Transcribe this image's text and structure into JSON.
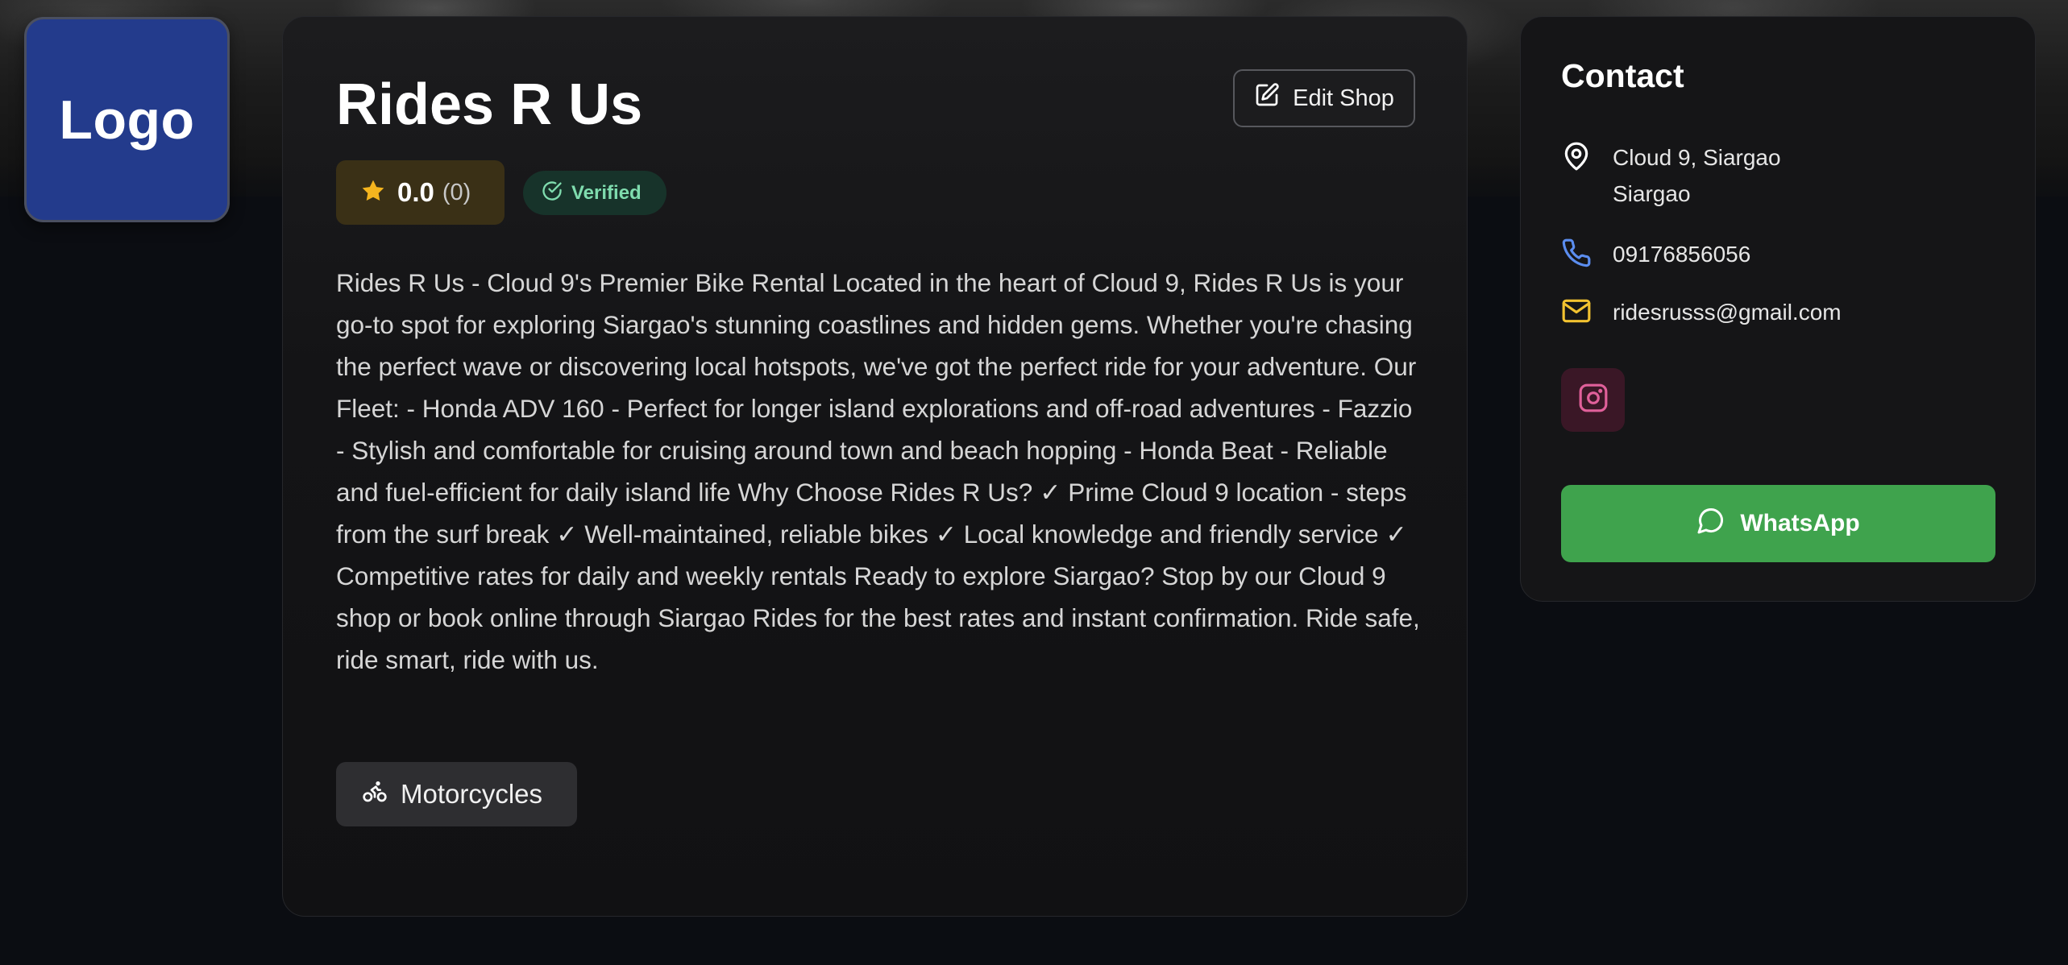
{
  "logo": {
    "text": "Logo"
  },
  "shop": {
    "name": "Rides R Us",
    "edit_label": "Edit Shop",
    "rating": {
      "value": "0.0",
      "count": "(0)"
    },
    "verified_label": "Verified",
    "description": "Rides R Us - Cloud 9's Premier Bike Rental Located in the heart of Cloud 9, Rides R Us is your go-to spot for exploring Siargao's stunning coastlines and hidden gems. Whether you're chasing the perfect wave or discovering local hotspots, we've got the perfect ride for your adventure. Our Fleet: - Honda ADV 160 - Perfect for longer island explorations and off-road adventures - Fazzio - Stylish and comfortable for cruising around town and beach hopping - Honda Beat - Reliable and fuel-efficient for daily island life Why Choose Rides R Us? ✓ Prime Cloud 9 location - steps from the surf break ✓ Well-maintained, reliable bikes ✓ Local knowledge and friendly service ✓ Competitive rates for daily and weekly rentals Ready to explore Siargao? Stop by our Cloud 9 shop or book online through Siargao Rides for the best rates and instant confirmation. Ride safe, ride smart, ride with us.",
    "categories": [
      "Motorcycles"
    ]
  },
  "contact": {
    "title": "Contact",
    "address_line1": "Cloud 9, Siargao",
    "address_line2": "Siargao",
    "phone": "09176856056",
    "email": "ridesrusss@gmail.com",
    "whatsapp_label": "WhatsApp"
  },
  "icons": {
    "edit": "edit-icon",
    "rating": "star-icon",
    "verified": "check-circle-icon",
    "category": "bike-icon",
    "address": "map-pin-icon",
    "phone": "phone-icon",
    "email": "mail-icon",
    "social": "instagram-icon",
    "chat": "message-circle-icon"
  },
  "colors": {
    "logo_bg": "#233b8c",
    "star": "#f5b51e",
    "verified": "#7fdcae",
    "phone_icon": "#5b8def",
    "mail_icon": "#f2c230",
    "instagram": "#e0609a",
    "whatsapp": "#3fa34d"
  }
}
